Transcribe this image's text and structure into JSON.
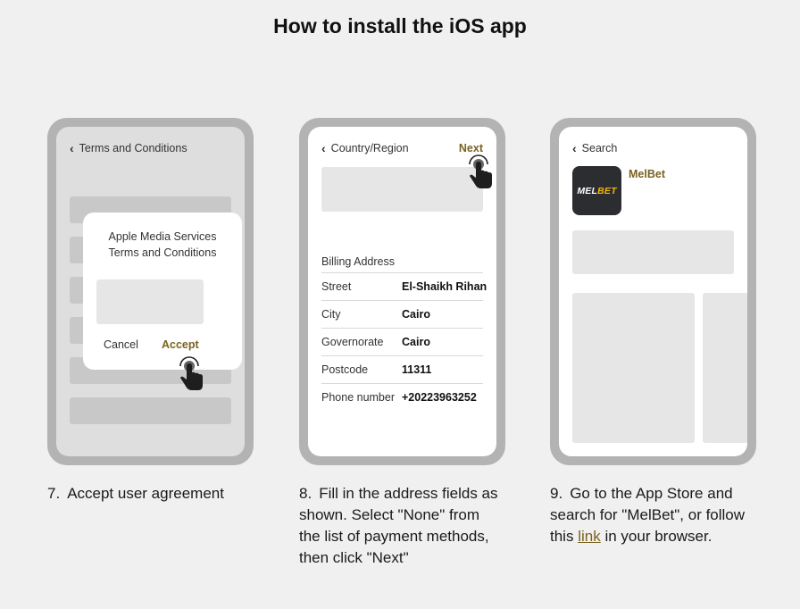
{
  "page": {
    "title": "How to install the iOS app"
  },
  "steps": [
    {
      "number": "7.",
      "caption": "Accept user agreement",
      "screen": {
        "header": "Terms and Conditions",
        "modal": {
          "title_line1": "Apple Media Services",
          "title_line2": "Terms and Conditions",
          "cancel_label": "Cancel",
          "accept_label": "Accept"
        }
      }
    },
    {
      "number": "8.",
      "caption_lines": [
        "Fill in the address fields as",
        "shown. Select \"None\" from",
        "the list of payment methods,",
        "then click \"Next\""
      ],
      "screen": {
        "header": "Country/Region",
        "next_label": "Next",
        "billing_label": "Billing Address",
        "rows": [
          {
            "key": "Street",
            "value": "El-Shaikh Rihan"
          },
          {
            "key": "City",
            "value": "Cairo"
          },
          {
            "key": "Governorate",
            "value": "Cairo"
          },
          {
            "key": "Postcode",
            "value": "11311"
          },
          {
            "key": "Phone number",
            "value": "+20223963252"
          }
        ]
      }
    },
    {
      "number": "9.",
      "caption_line1": "Go to the App Store and",
      "caption_line2": "search for \"MelBet\", or follow",
      "caption_line3_pre": "this",
      "caption_link": "link",
      "caption_line3_post": "in your browser.",
      "screen": {
        "header": "Search",
        "app_name": "MelBet",
        "icon_text_main": "MEL",
        "icon_text_accent": "BET"
      }
    }
  ],
  "colors": {
    "accent": "#7a6220",
    "phone_frame": "#b3b3b3",
    "background": "#f0f0f0"
  },
  "icons": {
    "back": "chevron-left-icon",
    "tap": "tap-hand-icon"
  }
}
